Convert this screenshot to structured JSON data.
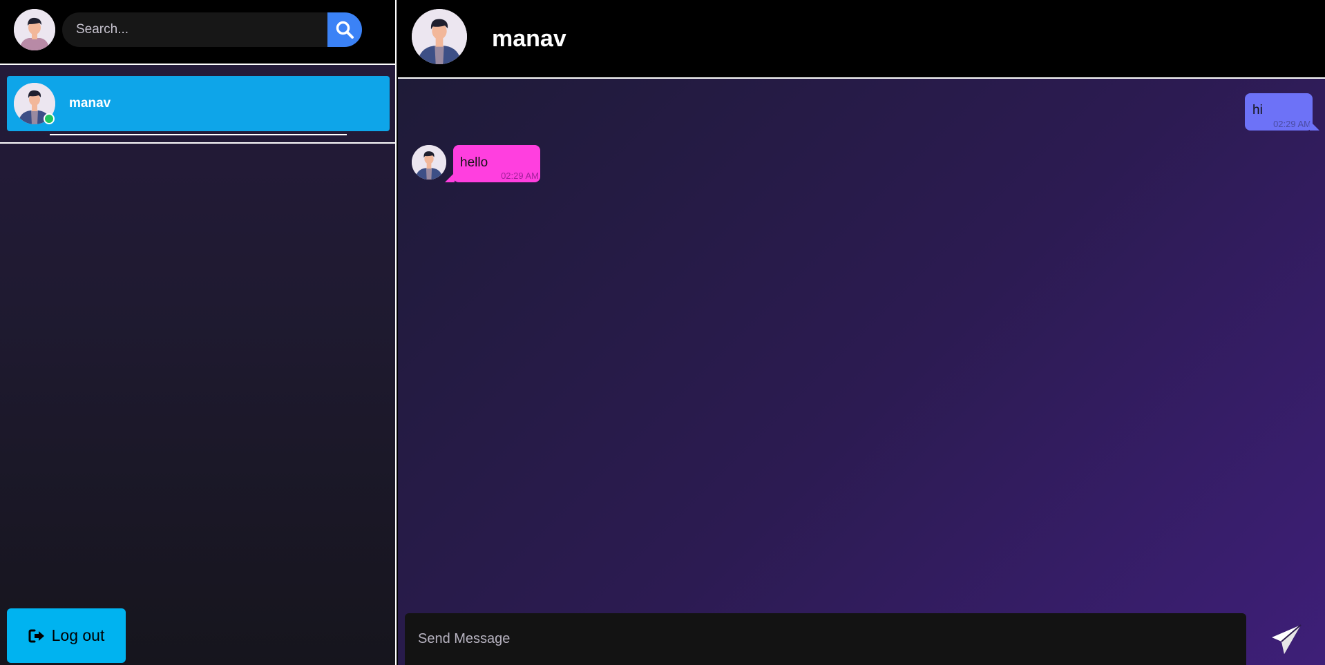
{
  "sidebar": {
    "search": {
      "placeholder": "Search..."
    },
    "contacts": [
      {
        "name": "manav",
        "status": "online",
        "selected": true
      }
    ],
    "logout_label": "Log out"
  },
  "chat": {
    "header": {
      "name": "manav"
    },
    "messages": [
      {
        "direction": "outgoing",
        "text": "hi",
        "time": "02:29 AM"
      },
      {
        "direction": "incoming",
        "text": "hello",
        "time": "02:29 AM"
      }
    ],
    "composer": {
      "placeholder": "Send Message"
    }
  },
  "icons": {
    "search": "magnifier-icon",
    "logout": "sign-out-icon",
    "send": "paper-plane-icon"
  },
  "colors": {
    "contact_selected": "#0ea5e9",
    "search_button": "#3b82f6",
    "logout_button": "#00b3f0",
    "outgoing_bubble": "#6d72f7",
    "incoming_bubble": "#ff3fdf",
    "online": "#22c55e"
  }
}
